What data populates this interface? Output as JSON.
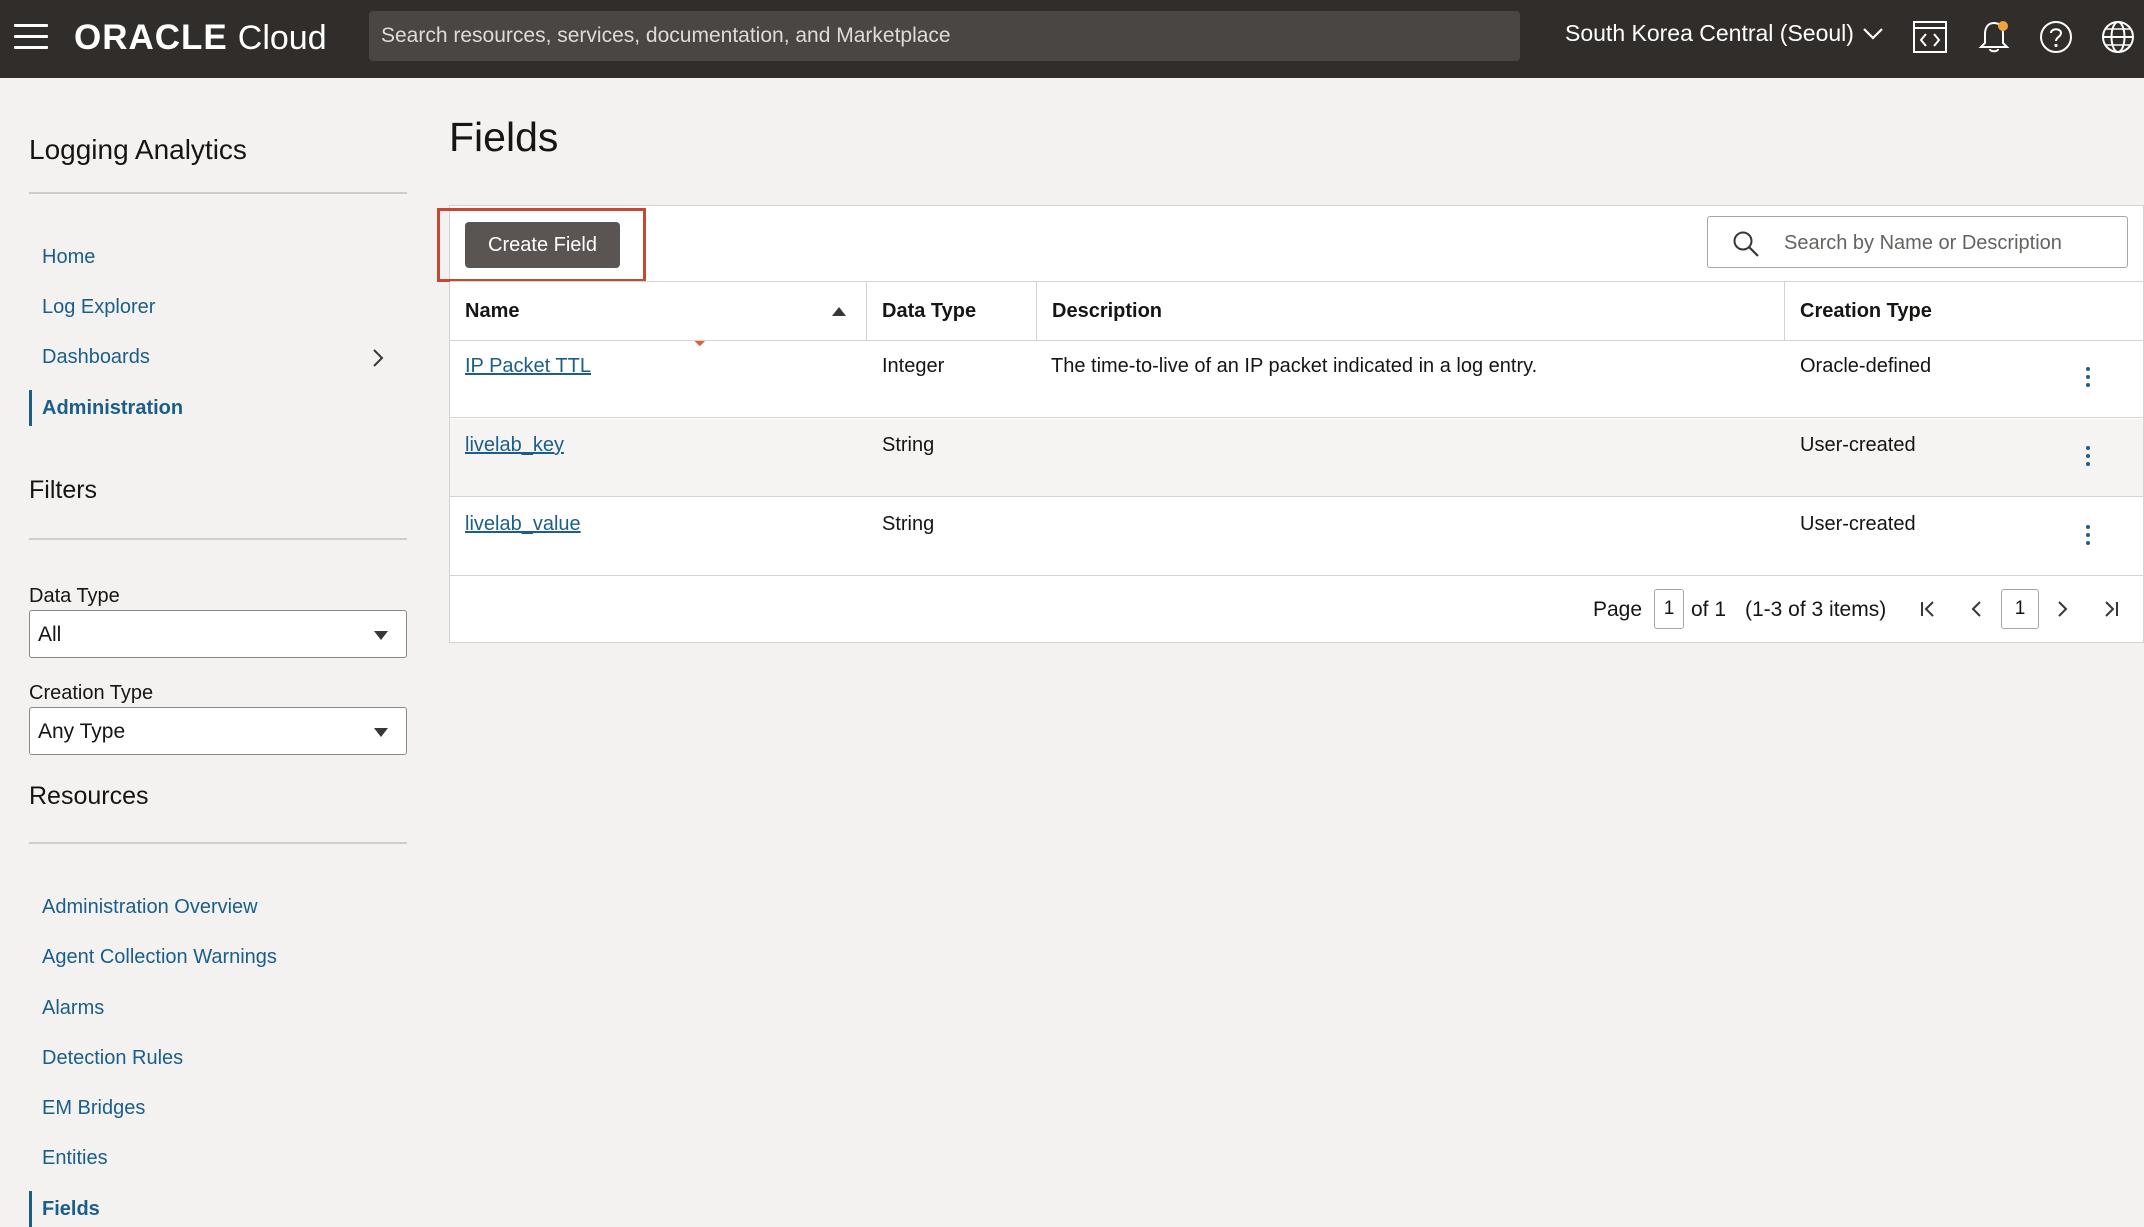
{
  "header": {
    "brand": "ORACLE",
    "product": "Cloud",
    "search_placeholder": "Search resources, services, documentation, and Marketplace",
    "region": "South Korea Central (Seoul)",
    "icons": [
      "menu-icon",
      "code-editor-icon",
      "notification-bell-icon",
      "help-icon",
      "language-globe-icon"
    ]
  },
  "sidebar": {
    "title": "Logging Analytics",
    "nav": [
      {
        "label": "Home"
      },
      {
        "label": "Log Explorer"
      },
      {
        "label": "Dashboards"
      },
      {
        "label": "Administration"
      }
    ],
    "filters_title": "Filters",
    "data_type_label": "Data Type",
    "data_type_value": "All",
    "creation_type_label": "Creation Type",
    "creation_type_value": "Any Type",
    "resources_title": "Resources",
    "resources": [
      {
        "label": "Administration Overview"
      },
      {
        "label": "Agent Collection Warnings"
      },
      {
        "label": "Alarms"
      },
      {
        "label": "Detection Rules"
      },
      {
        "label": "EM Bridges"
      },
      {
        "label": "Entities"
      },
      {
        "label": "Fields"
      }
    ]
  },
  "main": {
    "title": "Fields",
    "create_button": "Create Field",
    "search_placeholder": "Search by Name or Description",
    "columns": [
      "Name",
      "Data Type",
      "Description",
      "Creation Type"
    ],
    "rows": [
      {
        "name": "IP Packet TTL",
        "data_type": "Integer",
        "description": "The time-to-live of an IP packet indicated in a log entry.",
        "creation_type": "Oracle-defined"
      },
      {
        "name": "livelab_key",
        "data_type": "String",
        "description": "",
        "creation_type": "User-created"
      },
      {
        "name": "livelab_value",
        "data_type": "String",
        "description": "",
        "creation_type": "User-created"
      }
    ],
    "pagination": {
      "page_label": "Page",
      "page_value": "1",
      "of_label": "of 1",
      "items_label": "(1-3 of 3 items)",
      "current_page": "1"
    }
  },
  "colors": {
    "header_bg": "#312d2a",
    "link": "#1b5e89",
    "highlight": "#c74634",
    "button": "#5a5552"
  }
}
